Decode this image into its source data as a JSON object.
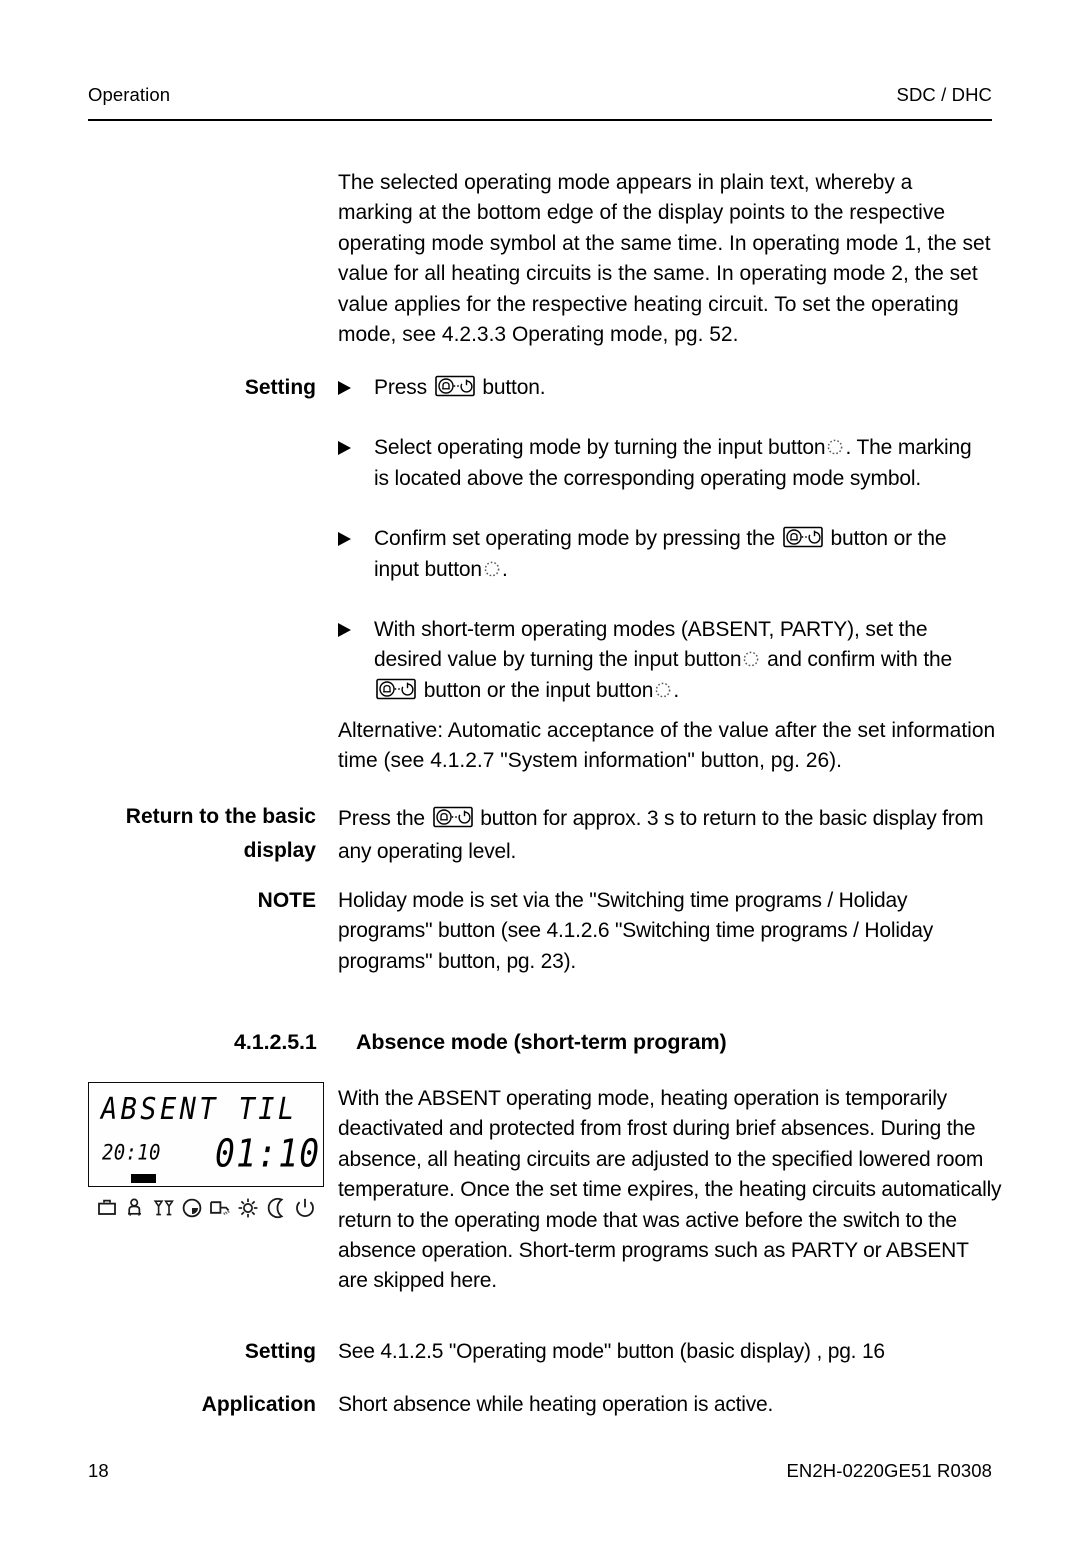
{
  "header": {
    "left": "Operation",
    "right": "SDC / DHC"
  },
  "intro": {
    "paragraph": "The selected operating mode appears in plain text, whereby a marking at the bottom edge of the display points to the respective operating mode symbol at the same time. In operating mode 1, the set value for all heating circuits is the same. In operating mode 2, the set value applies for the respective heating circuit. To set the operating mode, see 4.2.3.3 Operating mode, pg. 52."
  },
  "setting_block": {
    "label": "Setting",
    "bullets": [
      {
        "part1": "Press",
        "icon": "operating-mode-button-icon",
        "part2": "button."
      },
      {
        "part1": "Select operating mode by turning the input button",
        "icon": "input-knob-icon",
        "part2": ". The marking is located above the corresponding operating mode symbol."
      },
      {
        "part1": "Confirm set operating mode by pressing the",
        "icon": "operating-mode-button-icon",
        "part2": "button or the input button",
        "icon2": "input-knob-icon",
        "part3": "."
      },
      {
        "part1": "With short-term operating modes (ABSENT, PARTY), set the desired value by turning the input button",
        "icon": "input-knob-icon",
        "part2": "and confirm with the",
        "icon2": "operating-mode-button-icon",
        "part3": "button or the input button",
        "icon3": "input-knob-icon",
        "part4": "."
      }
    ],
    "alternative": "Alternative: Automatic acceptance of the value after the set information time (see 4.1.2.7 \"System information\" button, pg. 26)."
  },
  "return_block": {
    "label": "Return to the basic display",
    "label_line1": "Return to the basic",
    "label_line2": "display",
    "text_part1": "Press the",
    "icon": "operating-mode-button-icon",
    "text_part2": "button for approx. 3 s to return to the basic display from any operating level."
  },
  "note_block": {
    "label": "NOTE",
    "text": "Holiday mode is set via the \"Switching time programs / Holiday programs\" button (see 4.1.2.6 \"Switching time programs / Holiday programs\" button, pg. 23)."
  },
  "section": {
    "number": "4.1.2.5.1",
    "title": "Absence mode (short-term program)"
  },
  "figure": {
    "lcd_line1": "ABSENT TIL",
    "lcd_time_small": "20:10",
    "lcd_time_big": "01:10",
    "marker_position_index": 1,
    "symbols": [
      {
        "name": "holiday-suitcase-symbol",
        "label": "Holiday"
      },
      {
        "name": "absent-person-symbol",
        "label": "Absent"
      },
      {
        "name": "party-glasses-symbol",
        "label": "Party"
      },
      {
        "name": "automatic-clock-symbol",
        "label": "Automatic"
      },
      {
        "name": "domestic-hot-water-tap-symbol",
        "label": "Hot water"
      },
      {
        "name": "day-sun-symbol",
        "label": "Day / Comfort"
      },
      {
        "name": "night-moon-symbol",
        "label": "Night / Reduced"
      },
      {
        "name": "standby-power-symbol",
        "label": "Standby"
      }
    ]
  },
  "absence": {
    "body": "With the ABSENT operating mode, heating operation is temporarily deactivated and protected from frost during brief absences. During the absence, all heating circuits are adjusted to the specified lowered room temperature. Once the set time expires, the heating circuits automatically return to the operating mode that was active before the switch to the absence operation. Short-term programs such as PARTY or ABSENT are skipped here."
  },
  "setting_ref": {
    "label": "Setting",
    "text": "See 4.1.2.5 \"Operating mode\" button (basic display) , pg. 16"
  },
  "application": {
    "label": "Application",
    "text": "Short absence while heating operation is active."
  },
  "footer": {
    "page_number": "18",
    "document_code": "EN2H-0220GE51 R0308"
  }
}
